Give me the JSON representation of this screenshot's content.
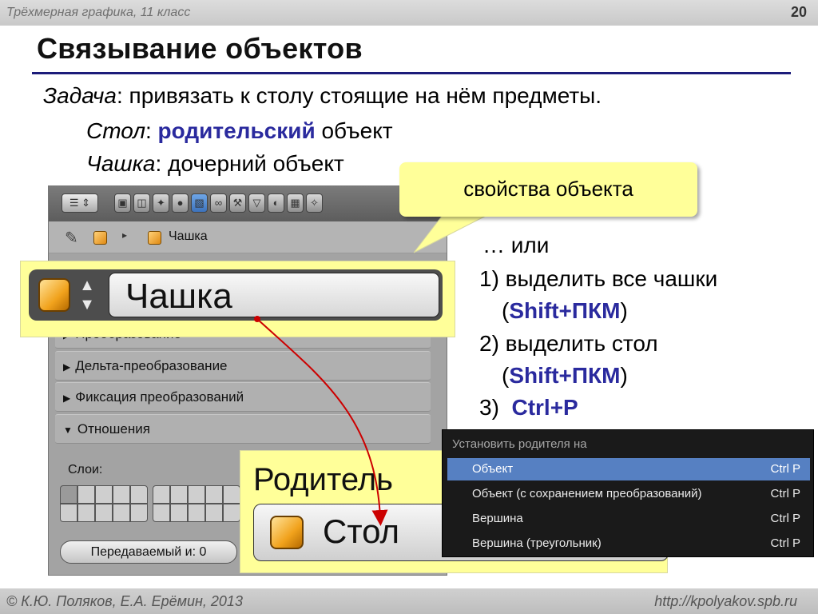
{
  "header": {
    "course": "Трёхмерная графика, 11 класс",
    "page_number": "20"
  },
  "title": "Связывание объектов",
  "task": {
    "label": "Задача",
    "text": ": привязать к столу стоящие на нём предметы."
  },
  "parent_line": {
    "label": "Стол",
    "sep": ": ",
    "highlight": "родительский",
    "rest": " объект"
  },
  "child_line": {
    "label": "Чашка",
    "text": ": дочерний объект"
  },
  "callout": "свойства объекта",
  "blender": {
    "breadcrumb": "Чашка",
    "object_name": "Чашка",
    "sections": [
      "Преобразование",
      "Дельта-преобразование",
      "Фиксация преобразований",
      "Отношения"
    ],
    "layers_label": "Слои:",
    "pass_index": "Передаваемый и: 0",
    "parent_label": "Родитель",
    "parent_value": "Стол"
  },
  "steps": {
    "or": "… или",
    "s1": "1) выделить все чашки",
    "s1_key": "Shift+ПКМ",
    "s2": "2) выделить стол",
    "s2_key": "Shift+ПКМ",
    "s3_num": "3)",
    "s3_key": "Ctrl+P"
  },
  "context_menu": {
    "title": "Установить родителя на",
    "items": [
      {
        "label": "Объект",
        "shortcut": "Ctrl P"
      },
      {
        "label": "Объект (с сохранением преобразований)",
        "shortcut": "Ctrl P"
      },
      {
        "label": "Вершина",
        "shortcut": "Ctrl P"
      },
      {
        "label": "Вершина (треугольник)",
        "shortcut": "Ctrl P"
      }
    ]
  },
  "footer": {
    "copyright": "© К.Ю. Поляков, Е.А. Ерёмин, 2013",
    "url": "http://kpolyakov.spb.ru"
  },
  "colors": {
    "accent": "#2a2a9e",
    "highlight_box": "#ffff99",
    "menu_selected": "#5680c2",
    "arrow": "#cc0000"
  }
}
